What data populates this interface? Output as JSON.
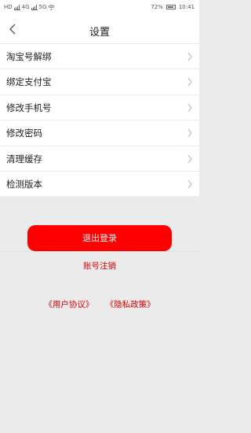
{
  "status_bar": {
    "left_labels": [
      "HD",
      "4G",
      "5G"
    ],
    "battery": "72%",
    "time": "10:41"
  },
  "header": {
    "title": "设置"
  },
  "settings_items": [
    {
      "label": "淘宝号解绑"
    },
    {
      "label": "绑定支付宝"
    },
    {
      "label": "修改手机号"
    },
    {
      "label": "修改密码"
    },
    {
      "label": "清理缓存"
    },
    {
      "label": "检测版本"
    }
  ],
  "actions": {
    "logout_label": "退出登录",
    "cancel_account_label": "账号注销"
  },
  "agreements": {
    "user_agreement": "《用户协议》",
    "privacy_policy": "《隐私政策》"
  },
  "colors": {
    "accent": "#ff0000",
    "background": "#ebebeb"
  }
}
